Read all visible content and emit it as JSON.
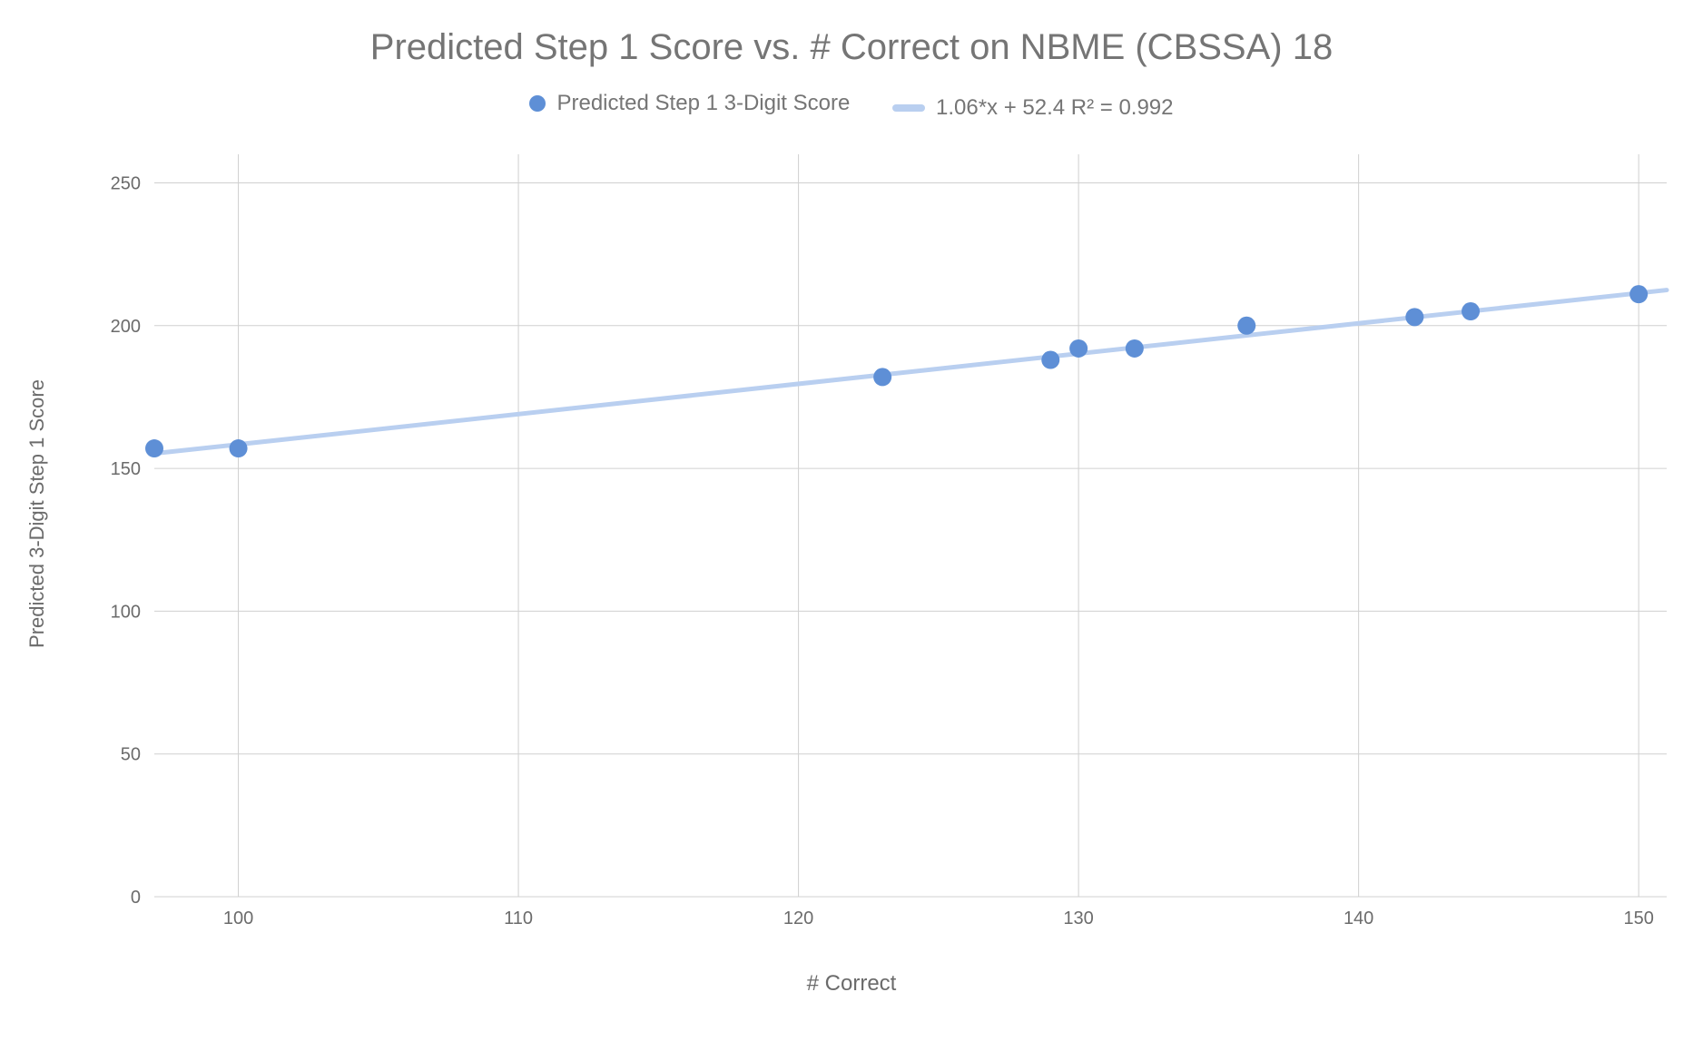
{
  "chart_data": {
    "type": "scatter",
    "title": "Predicted Step 1 Score vs. # Correct on NBME (CBSSA) 18",
    "xlabel": "# Correct",
    "ylabel": "Predicted 3-Digit Step 1 Score",
    "xlim": [
      97,
      151
    ],
    "ylim": [
      0,
      260
    ],
    "x_ticks": [
      100,
      110,
      120,
      130,
      140,
      150
    ],
    "y_ticks": [
      0,
      50,
      100,
      150,
      200,
      250
    ],
    "series": [
      {
        "name": "Predicted Step 1 3-Digit Score",
        "type": "scatter",
        "color": "#5e8fd6",
        "x": [
          97,
          100,
          123,
          129,
          130,
          132,
          136,
          142,
          144,
          150
        ],
        "values": [
          157,
          157,
          182,
          188,
          192,
          192,
          200,
          203,
          205,
          211
        ]
      }
    ],
    "trendline": {
      "label": "1.06*x + 52.4 R² = 0.992",
      "slope": 1.06,
      "intercept": 52.4,
      "r2": 0.992,
      "color": "#b9cff0"
    },
    "legend_items": [
      {
        "marker": "dot",
        "color": "#5e8fd6",
        "text": "Predicted Step 1 3-Digit Score"
      },
      {
        "marker": "line",
        "color": "#b9cff0",
        "text": "1.06*x + 52.4 R² = 0.992"
      }
    ]
  }
}
